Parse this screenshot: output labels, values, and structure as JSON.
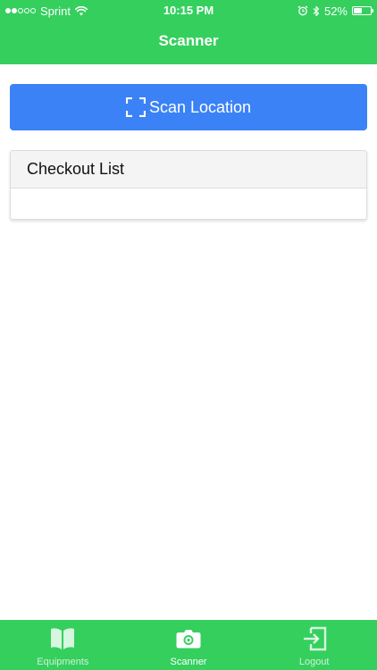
{
  "status_bar": {
    "carrier": "Sprint",
    "time": "10:15 PM",
    "battery_percent_label": "52%",
    "battery_level": 0.52,
    "signal_bars_filled": 2,
    "signal_bars_total": 5
  },
  "header": {
    "title": "Scanner"
  },
  "scan_button": {
    "label": "Scan Location",
    "icon": "scan-frame-icon"
  },
  "checkout_card": {
    "title": "Checkout List",
    "items": []
  },
  "tabs": [
    {
      "label": "Equipments",
      "icon": "book-icon",
      "active": false
    },
    {
      "label": "Scanner",
      "icon": "camera-icon",
      "active": true
    },
    {
      "label": "Logout",
      "icon": "logout-icon",
      "active": false
    }
  ],
  "colors": {
    "header_green": "#35cf5e",
    "button_blue": "#3b82f6",
    "card_header_bg": "#f4f4f4"
  }
}
